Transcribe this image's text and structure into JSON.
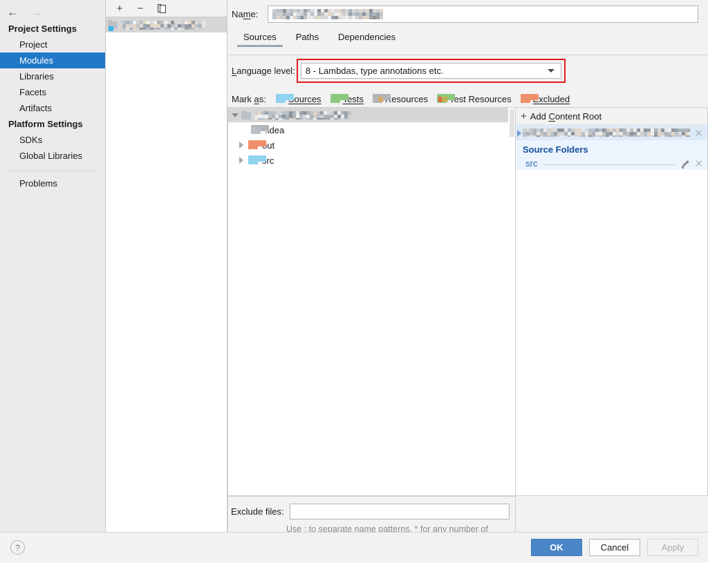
{
  "nav": {
    "back_icon": "arrow-left-icon",
    "forward_icon": "arrow-right-icon"
  },
  "sidebar": {
    "groups": [
      {
        "title": "Project Settings",
        "items": [
          {
            "label": "Project",
            "selected": false
          },
          {
            "label": "Modules",
            "selected": true
          },
          {
            "label": "Libraries",
            "selected": false
          },
          {
            "label": "Facets",
            "selected": false
          },
          {
            "label": "Artifacts",
            "selected": false
          }
        ]
      },
      {
        "title": "Platform Settings",
        "items": [
          {
            "label": "SDKs",
            "selected": false
          },
          {
            "label": "Global Libraries",
            "selected": false
          }
        ]
      }
    ],
    "problems_label": "Problems"
  },
  "module_list": {
    "toolbar": {
      "add_label": "+",
      "remove_label": "−",
      "copy_icon": "copy-icon"
    },
    "selected_module_name": "",
    "selected_module_redacted": true
  },
  "main": {
    "name_label": "Name:",
    "name_label_mnemonic": "m",
    "name_value": "",
    "name_value_redacted": true,
    "tabs": [
      {
        "label": "Sources",
        "active": true
      },
      {
        "label": "Paths",
        "active": false
      },
      {
        "label": "Dependencies",
        "active": false
      }
    ],
    "language_level": {
      "label": "Language level:",
      "value": "8 - Lambdas, type annotations etc.",
      "highlight_color": "#e01b1b",
      "caret_icon": "chevron-down-icon"
    },
    "mark_as": {
      "label": "Mark as:",
      "options": [
        {
          "label": "Sources",
          "color": "#8fd3ef",
          "icon": "folder-sources-icon"
        },
        {
          "label": "Tests",
          "color": "#8cc87e",
          "icon": "folder-tests-icon"
        },
        {
          "label": "Resources",
          "color": "#b0b5ba",
          "icon": "folder-resources-icon"
        },
        {
          "label": "Test Resources",
          "color": "#8cc87e",
          "icon": "folder-test-resources-icon"
        },
        {
          "label": "Excluded",
          "color": "#f0906b",
          "icon": "folder-excluded-icon"
        }
      ]
    },
    "tree": {
      "root": {
        "label": "",
        "redacted": true,
        "expanded": true,
        "icon": "module-folder-icon"
      },
      "nodes": [
        {
          "label": ".idea",
          "color": "#b9c0c6",
          "expandable": false,
          "icon": "folder-icon"
        },
        {
          "label": "out",
          "color": "#f0906b",
          "expandable": true,
          "icon": "folder-excluded-icon"
        },
        {
          "label": "src",
          "color": "#8fd3ef",
          "expandable": true,
          "icon": "folder-sources-icon"
        }
      ]
    },
    "content_roots": {
      "add_label": "Add Content Root",
      "add_icon": "plus-icon",
      "root_path": "",
      "root_path_redacted": true,
      "remove_root_icon": "close-icon",
      "section_title": "Source Folders",
      "section_color": "#15509c",
      "folders": [
        {
          "name": "src",
          "edit_icon": "pencil-icon",
          "remove_icon": "close-icon"
        }
      ]
    },
    "exclude": {
      "label": "Exclude files:",
      "value": "",
      "hint": "Use ; to separate name patterns, * for any number of symbols, ? for one."
    }
  },
  "footer": {
    "help_label": "?",
    "ok_label": "OK",
    "cancel_label": "Cancel",
    "apply_label": "Apply",
    "ok_color": "#4a86c8",
    "apply_enabled": false
  }
}
